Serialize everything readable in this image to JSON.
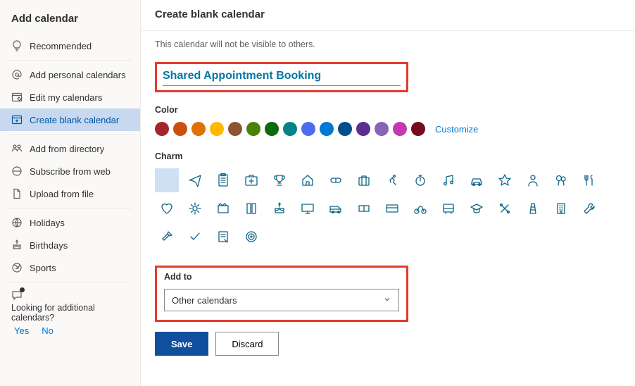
{
  "sidebar": {
    "title": "Add calendar",
    "items": [
      {
        "label": "Recommended",
        "icon": "bulb"
      },
      {
        "label": "Add personal calendars",
        "icon": "at"
      },
      {
        "label": "Edit my calendars",
        "icon": "edit-cal"
      },
      {
        "label": "Create blank calendar",
        "icon": "blank-cal",
        "active": true
      },
      {
        "label": "Add from directory",
        "icon": "directory"
      },
      {
        "label": "Subscribe from web",
        "icon": "web"
      },
      {
        "label": "Upload from file",
        "icon": "file"
      },
      {
        "label": "Holidays",
        "icon": "globe"
      },
      {
        "label": "Birthdays",
        "icon": "cake"
      },
      {
        "label": "Sports",
        "icon": "sports"
      }
    ],
    "footer_text": "Looking for additional calendars?",
    "yes": "Yes",
    "no": "No"
  },
  "main": {
    "title": "Create blank calendar",
    "helper": "This calendar will not be visible to others.",
    "name_value": "Shared Appointment Booking",
    "color_label": "Color",
    "customize": "Customize",
    "colors": [
      "#a4262c",
      "#ca5010",
      "#e07000",
      "#ffb900",
      "#8e562e",
      "#498205",
      "#0b6a0b",
      "#038387",
      "#4f6bed",
      "#0078d4",
      "#004e8c",
      "#5c2e91",
      "#8764b8",
      "#c239b3",
      "#750b1c"
    ],
    "charm_label": "Charm",
    "charms": [
      "none",
      "plane",
      "clipboard",
      "medkit",
      "trophy",
      "home",
      "pill",
      "suitcase",
      "running",
      "timer",
      "music",
      "car",
      "star",
      "person",
      "balloons",
      "food",
      "heart",
      "gear",
      "movie",
      "book",
      "cake",
      "monitor",
      "van",
      "ticket",
      "creditcard",
      "bike",
      "bus",
      "grad",
      "tools",
      "tower",
      "building",
      "wrench",
      "axe",
      "check",
      "note",
      "target"
    ],
    "addto_label": "Add to",
    "addto_value": "Other calendars",
    "save": "Save",
    "discard": "Discard"
  }
}
